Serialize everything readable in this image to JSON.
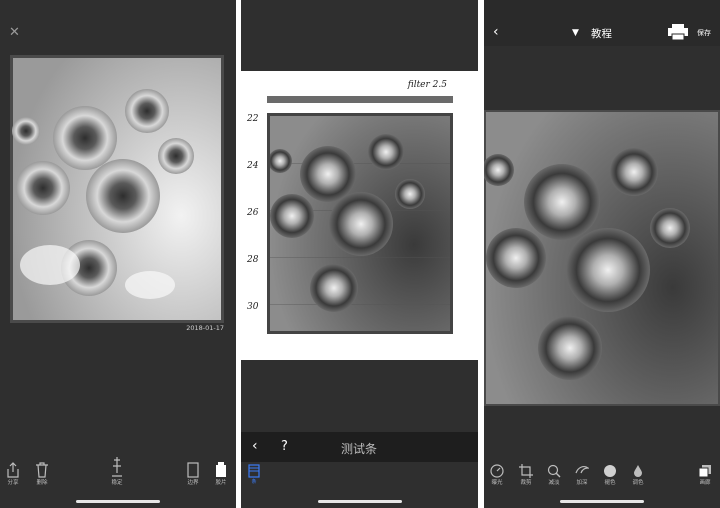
{
  "panel1": {
    "photo_date": "2018-01-17",
    "tools": [
      {
        "label": "分享",
        "icon": "share-icon"
      },
      {
        "label": "删除",
        "icon": "trash-icon"
      },
      {
        "label": "稳定",
        "icon": "enlarger-icon"
      },
      {
        "label": "边界",
        "icon": "border-icon"
      },
      {
        "label": "胶片",
        "icon": "film-icon"
      }
    ]
  },
  "panel2": {
    "filter_label": "filter 2.5",
    "ruler": [
      "22",
      "24",
      "26",
      "28",
      "30"
    ],
    "nav_title": "测试条",
    "help": "?",
    "strip_tool_label": "条"
  },
  "panel3": {
    "title": "教程",
    "save": "保存",
    "tools": [
      {
        "label": "曝光",
        "icon": "exposure-dial-icon"
      },
      {
        "label": "裁剪",
        "icon": "crop-icon"
      },
      {
        "label": "减淡",
        "icon": "magnifier-icon"
      },
      {
        "label": "加深",
        "icon": "burn-hand-icon"
      },
      {
        "label": "褪色",
        "icon": "circle-icon"
      },
      {
        "label": "调色",
        "icon": "drop-icon"
      },
      {
        "label": "画廊",
        "icon": "gallery-icon"
      }
    ]
  },
  "colors": {
    "accent": "#3b7bf5",
    "panel_bg": "#2f2f2f"
  }
}
